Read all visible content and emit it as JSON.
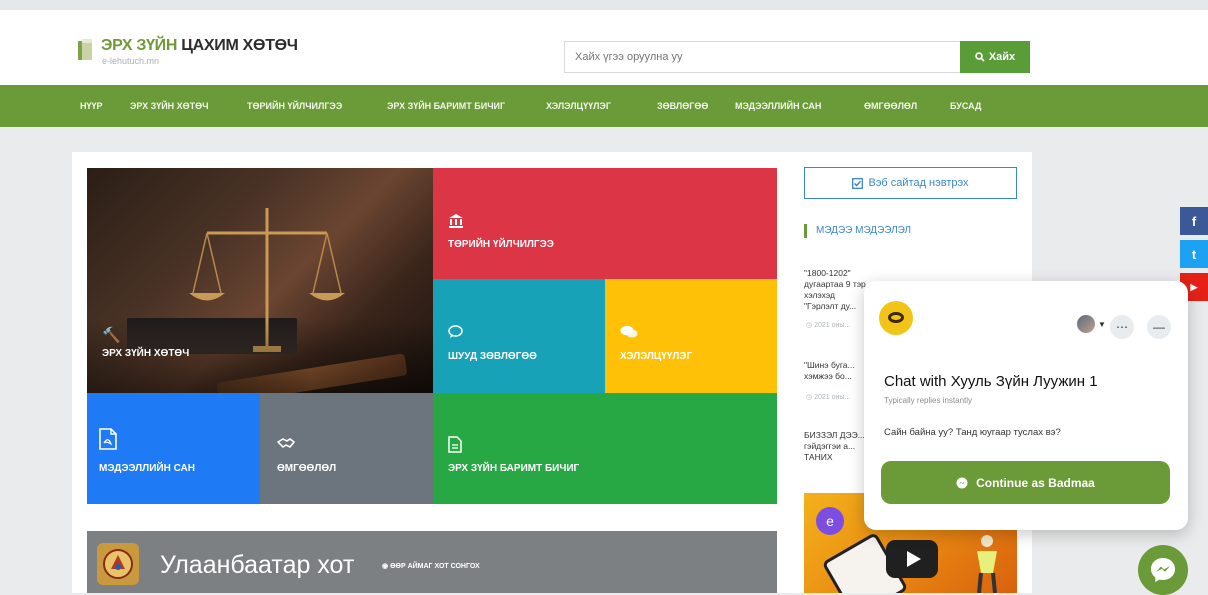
{
  "header": {
    "logo_prefix": "ЭРХ ЗҮЙН",
    "logo_suffix": " ЦАХИМ ХӨТӨЧ",
    "logo_sub": "e-lehutuch.mn",
    "search_placeholder": "Хайх үгээ оруулна уу",
    "search_button": "Хайх"
  },
  "nav": {
    "items": [
      "НҮҮР",
      "ЭРХ ЗҮЙН ХӨТӨЧ",
      "ТӨРИЙН ҮЙЛЧИЛГЭЭ",
      "ЭРХ ЗҮЙН БАРИМТ БИЧИГ",
      "ХЭЛЭЛЦҮҮЛЭГ",
      "ЗӨВЛӨГӨӨ",
      "МЭДЭЭЛЛИЙН САН",
      "ӨМГӨӨЛӨЛ",
      "БУСАД"
    ]
  },
  "tiles": {
    "guide": "ЭРХ ЗҮЙН ХӨТӨЧ",
    "public_service": "ТӨРИЙН ҮЙЛЧИЛГЭЭ",
    "live_advice": "ШУУД ЗӨВЛӨГӨӨ",
    "discussion": "ХЭЛЭЛЦҮҮЛЭГ",
    "info_bank": "МЭДЭЭЛЛИЙН САН",
    "advocacy": "ӨМГӨӨЛӨЛ",
    "legal_docs": "ЭРХ ЗҮЙН БАРИМТ БИЧИГ"
  },
  "banner": {
    "title": "Улаанбаатар хот",
    "subtitle": "ӨӨР АЙМАГ ХОТ СОНГОХ"
  },
  "sidebar": {
    "register_button": "Вэб сайтад нэвтрэх",
    "section_title": "МЭДЭЭ МЭДЭЭЛЭЛ",
    "news": [
      {
        "text": "\"1800-1202\" дугаартаа 9 тэр хэлэхэд \"Гэрлэлт ду... хүрээнд бо...",
        "date": "2021 оны..."
      },
      {
        "text": "\"Шинэ буга... хэмжээ бо...",
        "date": "2021 оны..."
      },
      {
        "text": "БИЗЗЭЛ ДЭЭ... гэйдэггэи а... ТАНИХ ХЭРЭГ...",
        "date": ""
      }
    ]
  },
  "video": {
    "avatar_letter": "e"
  },
  "social": [
    "f",
    "t",
    "▶"
  ],
  "chat": {
    "title": "Chat with Хууль Зүйн Луужин 1",
    "subtitle": "Typically replies instantly",
    "message": "Сайн байна уу? Танд юугаар туслах вэ?",
    "button": "Continue as Badmaa"
  },
  "colors": {
    "nav_green": "#6b9a38",
    "red": "#dc3545",
    "teal": "#17a2b8",
    "yellow": "#ffc107",
    "blue": "#1e7bf5",
    "gray": "#6c757d",
    "green": "#28a745"
  }
}
